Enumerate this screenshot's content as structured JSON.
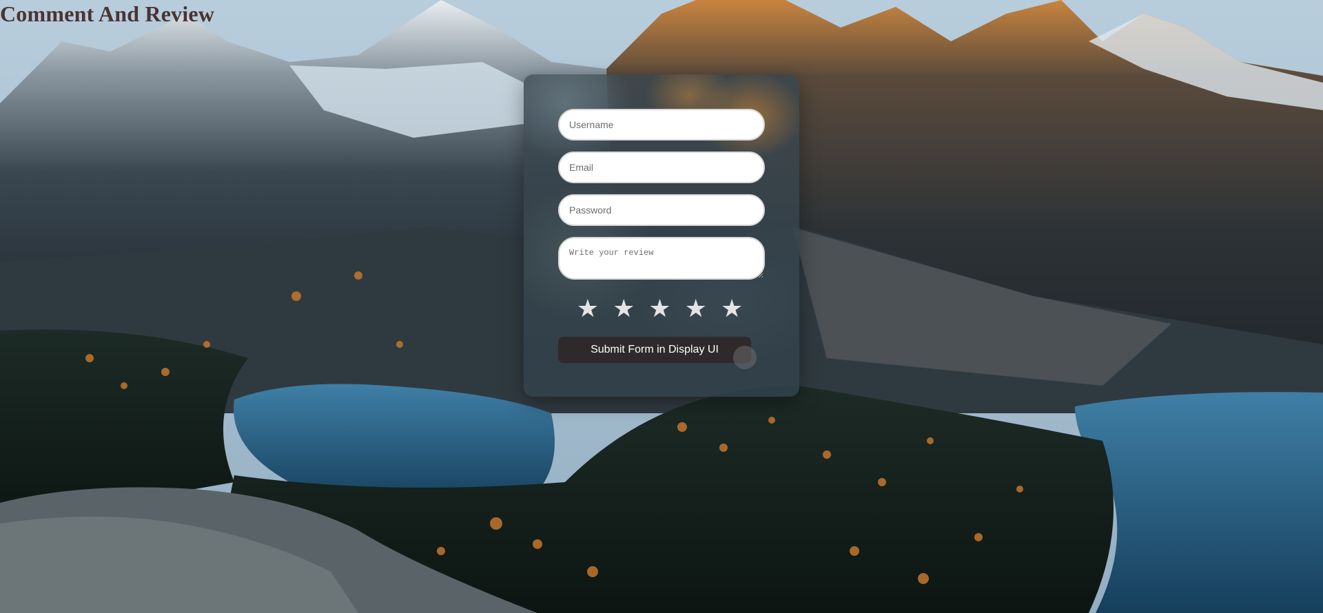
{
  "page": {
    "title": "Comment And Review"
  },
  "form": {
    "username_placeholder": "Username",
    "email_placeholder": "Email",
    "password_placeholder": "Password",
    "review_placeholder": "Write your review",
    "rating": {
      "stars": [
        "★",
        "★",
        "★",
        "★",
        "★"
      ]
    },
    "submit_label": "Submit Form in Display UI"
  },
  "colors": {
    "title": "#4a3432",
    "button_bg": "#2e2a2c",
    "star": "#e3e3e3"
  }
}
